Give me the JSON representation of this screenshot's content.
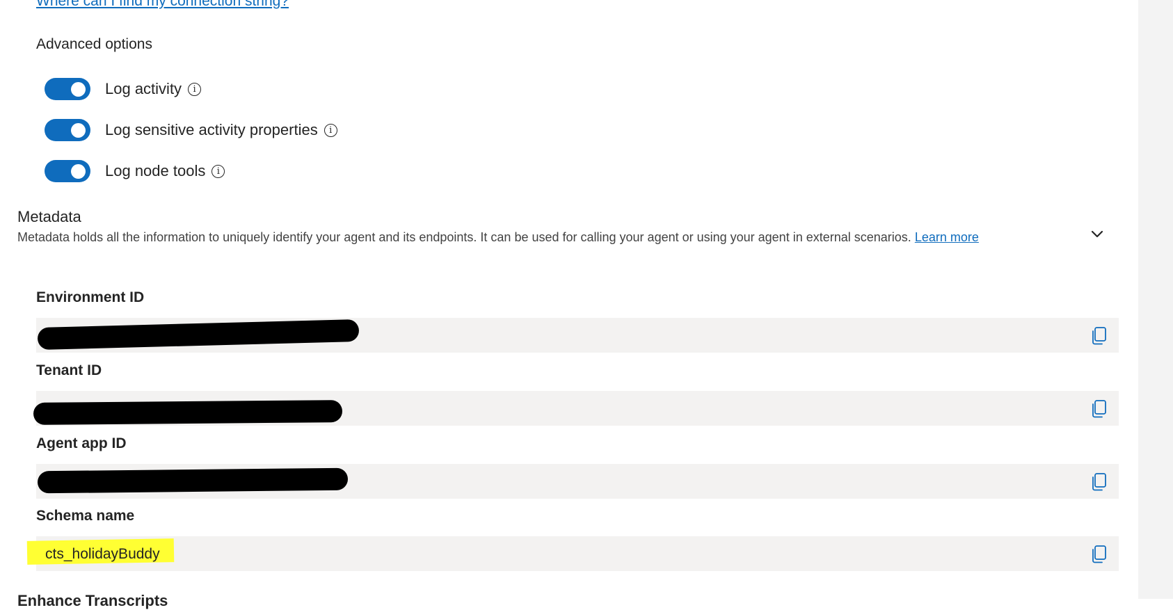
{
  "connection": {
    "help_link": "Where can I find my connection string?"
  },
  "advanced": {
    "title": "Advanced options",
    "toggles": [
      {
        "label": "Log activity",
        "on": true
      },
      {
        "label": "Log sensitive activity properties",
        "on": true
      },
      {
        "label": "Log node tools",
        "on": true
      }
    ]
  },
  "metadata": {
    "title": "Metadata",
    "description": "Metadata holds all the information to uniquely identify your agent and its endpoints. It can be used for calling your agent or using your agent in external scenarios.",
    "learn_more": "Learn more",
    "fields": [
      {
        "label": "Environment ID",
        "value": ""
      },
      {
        "label": "Tenant ID",
        "value": ""
      },
      {
        "label": "Agent app ID",
        "value": ""
      },
      {
        "label": "Schema name",
        "value": "cts_holidayBuddy"
      }
    ]
  },
  "next_section": {
    "partial_title": "Enhance Transcripts"
  },
  "colors": {
    "accent": "#0f6cbd",
    "field_bg": "#f3f2f1",
    "highlight": "#ffff33",
    "redaction": "#000000"
  }
}
